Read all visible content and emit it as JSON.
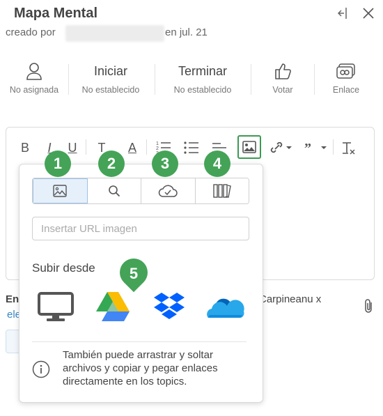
{
  "header": {
    "title": "Mapa Mental",
    "created_by_prefix": "creado por",
    "created_date": "en jul. 21"
  },
  "meta": {
    "assignee": {
      "sub": "No asignada"
    },
    "start": {
      "label": "Iniciar",
      "sub": "No establecido"
    },
    "end": {
      "label": "Terminar",
      "sub": "No establecido"
    },
    "vote": {
      "sub": "Votar"
    },
    "link": {
      "sub": "Enlace"
    }
  },
  "toolbar": {
    "bold": "B",
    "italic": "I",
    "underline": "U",
    "text_size": "T",
    "text_color": "A"
  },
  "image_popup": {
    "badges": [
      "1",
      "2",
      "3",
      "4",
      "5"
    ],
    "url_placeholder": "Insertar URL imagen",
    "upload_label": "Subir desde",
    "info_text": "También puede arrastrar y soltar archivos y copiar y pegar enlaces directamente en los topics."
  },
  "background": {
    "left_fragment": "En",
    "left_link": "ele",
    "right_fragment": "Carpineanu x"
  },
  "colors": {
    "accent_green": "#44a357",
    "active_tab_bg": "#e6f0fa"
  }
}
